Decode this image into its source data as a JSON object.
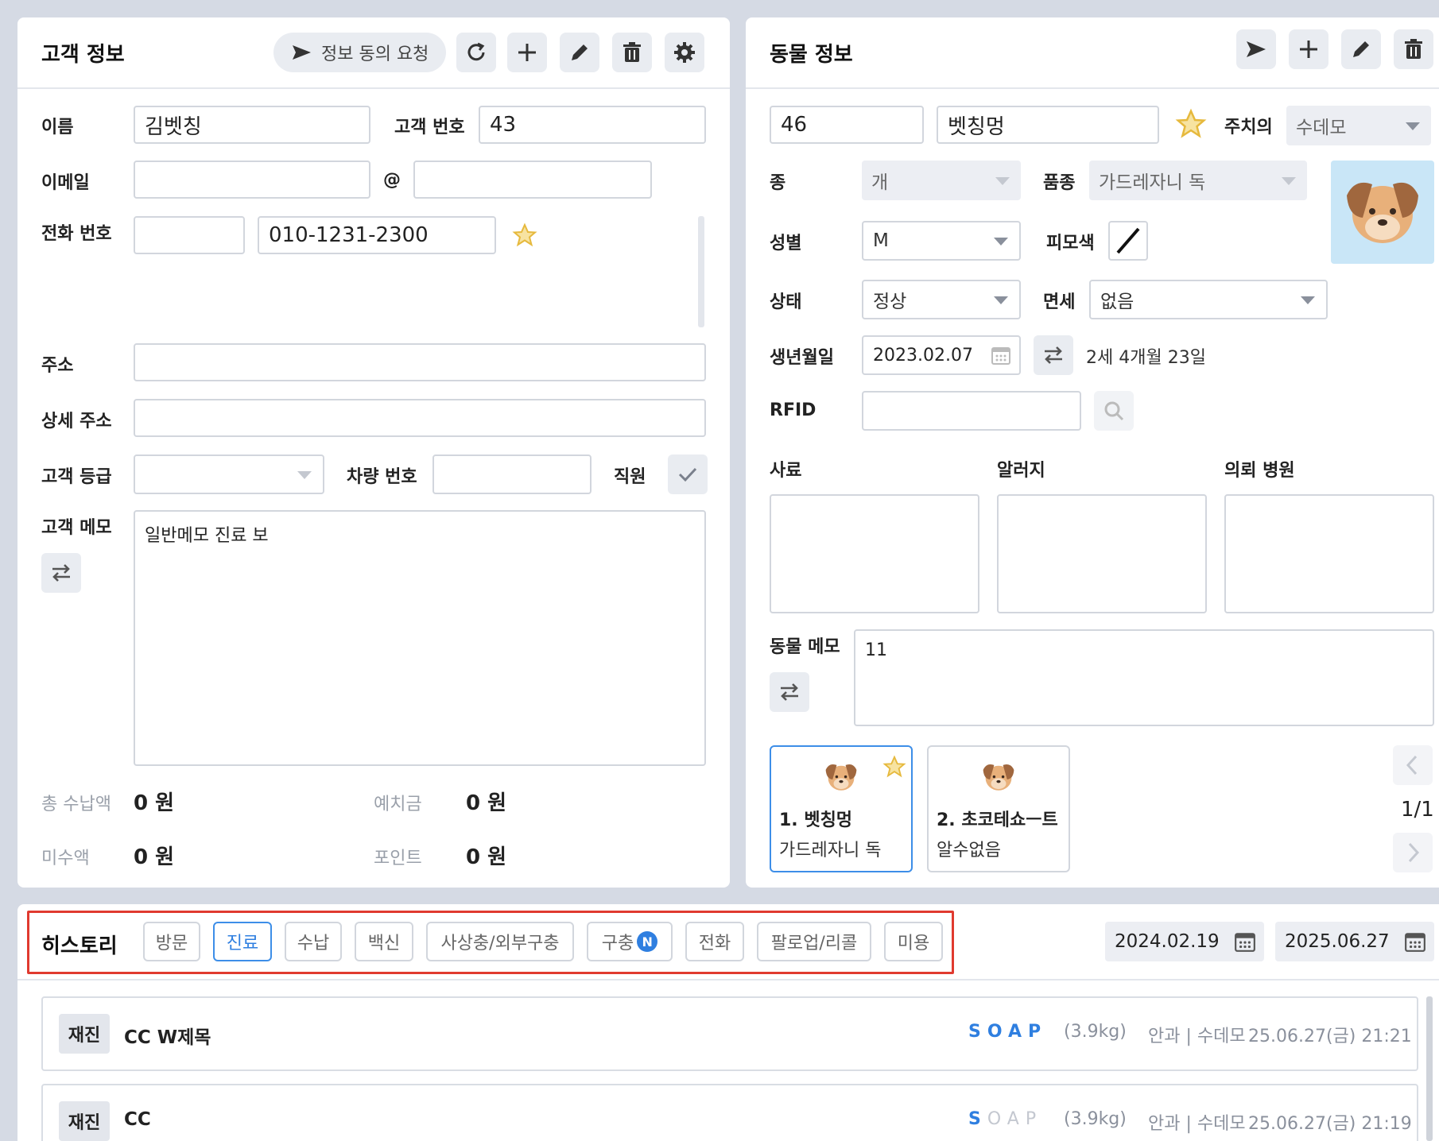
{
  "customer": {
    "title": "고객 정보",
    "consent_button": "정보 동의 요청",
    "labels": {
      "name": "이름",
      "customer_no": "고객 번호",
      "email": "이메일",
      "at": "@",
      "phone": "전화 번호",
      "address": "주소",
      "address_detail": "상세 주소",
      "grade": "고객 등급",
      "car_no": "차량 번호",
      "staff": "직원",
      "memo": "고객 메모",
      "total_paid": "총 수납액",
      "deposit": "예치금",
      "unpaid": "미수액",
      "points": "포인트"
    },
    "values": {
      "name": "김벳칭",
      "customer_no": "43",
      "email_local": "",
      "email_domain": "",
      "phone_prefix": "",
      "phone": "010-1231-2300",
      "address": "",
      "address_detail": "",
      "grade": "",
      "car_no": "",
      "memo": "일반메모 진료 보",
      "total_paid": "0 원",
      "deposit": "0 원",
      "unpaid": "0 원",
      "points": "0 원"
    }
  },
  "animal": {
    "title": "동물 정보",
    "labels": {
      "attending": "주치의",
      "species": "종",
      "breed": "품종",
      "sex": "성별",
      "coat": "피모색",
      "status": "상태",
      "tax": "면세",
      "birth": "생년월일",
      "rfid": "RFID",
      "food": "사료",
      "allergy": "알러지",
      "referral": "의뢰 병원",
      "memo": "동물 메모"
    },
    "values": {
      "id": "46",
      "name": "벳칭멍",
      "attending": "수데모",
      "species": "개",
      "breed": "가드레자니 독",
      "sex": "M",
      "status": "정상",
      "tax": "없음",
      "birth": "2023.02.07",
      "age": "2세 4개월 23일",
      "rfid": "",
      "memo": "11"
    },
    "pets": [
      {
        "name": "1. 벳칭멍",
        "breed": "가드레자니 독"
      },
      {
        "name": "2. 초코테쇼ㅡ트",
        "breed": "알수없음"
      }
    ],
    "pager": "1/1"
  },
  "history": {
    "title": "히스토리",
    "tabs": [
      "방문",
      "진료",
      "수납",
      "백신",
      "사상충/외부구충",
      "구충",
      "전화",
      "팔로업/리콜",
      "미용"
    ],
    "new_badge": "N",
    "date_from": "2024.02.19",
    "date_to": "2025.06.27",
    "records": [
      {
        "badge": "재진",
        "title": "CC W제목",
        "soap": "SOAP",
        "weight": "(3.9kg)",
        "dept": "안과 | 수데모",
        "datetime": "25.06.27(금) 21:21"
      },
      {
        "badge": "재진",
        "title": "CC",
        "soap": "SOAP",
        "weight": "(3.9kg)",
        "dept": "안과 | 수데모",
        "datetime": "25.06.27(금) 21:19"
      }
    ]
  },
  "colors": {
    "accent": "#2f7fe0",
    "highlight_border": "#e03a2f",
    "star": "#f2c94c"
  }
}
